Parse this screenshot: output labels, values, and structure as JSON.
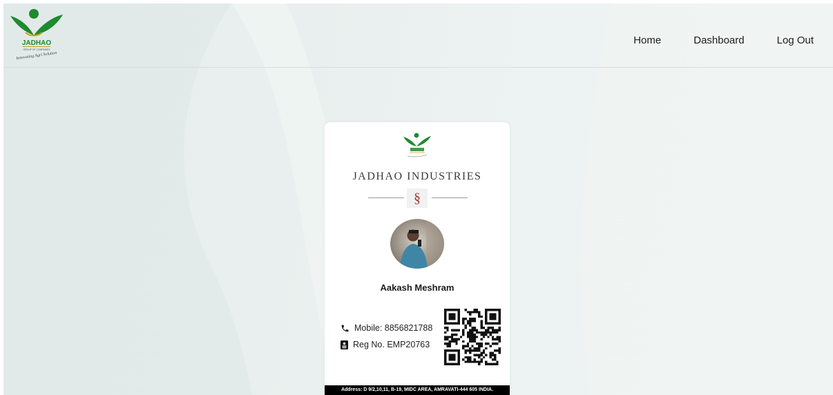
{
  "nav": {
    "links": [
      {
        "label": "Home"
      },
      {
        "label": "Dashboard"
      },
      {
        "label": "Log Out"
      }
    ]
  },
  "logo": {
    "brand": "JADHAO",
    "sub": "GROUP OF COMPANIES",
    "tagline": "Innovating Agri Solution",
    "colors": {
      "green": "#1f8a2e",
      "accent": "#c8a217"
    }
  },
  "card": {
    "company": "JADHAO INDUSTRIES",
    "symbol": "§",
    "name": "Aakash Meshram",
    "mobile": "Mobile: 8856821788",
    "reg": "Reg No. EMP20763",
    "address": "Address: D 9/2,10,11, B-19, MIDC AREA, AMRAVATI-444 605 INDIA.",
    "icons": {
      "phone": "phone-icon",
      "id": "id-badge-icon",
      "qr": "qr-code"
    }
  }
}
